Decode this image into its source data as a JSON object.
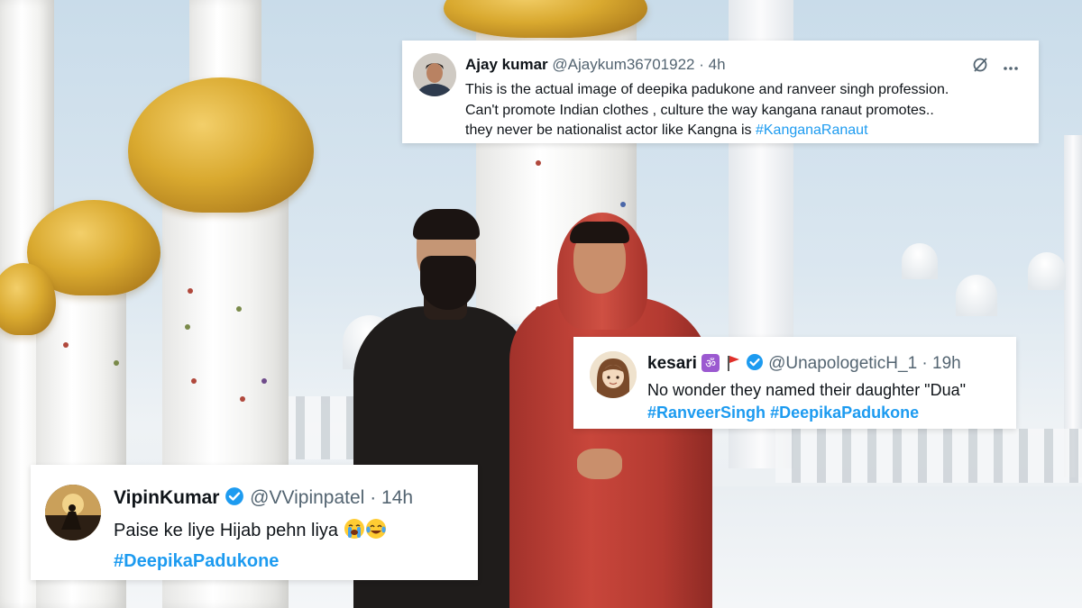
{
  "tweets": [
    {
      "name": "Ajay kumar",
      "handle": "@Ajaykum36701922",
      "time": "· 4h",
      "verified": false,
      "body_lines": [
        "This is the actual image of deepika padukone and ranveer singh profession.",
        "Can't promote Indian clothes , culture the way kangana ranaut promotes..",
        "they never be nationalist actor like Kangna is "
      ],
      "hashtags": [
        "#KanganaRanaut"
      ]
    },
    {
      "name": "kesari",
      "name_emojis": [
        "om-symbol-icon",
        "red-flag-icon"
      ],
      "handle": "@UnapologeticH_1",
      "time": "· 19h",
      "verified": true,
      "body_lines": [
        "No wonder they named their daughter \"Dua\""
      ],
      "hashtags": [
        "#RanveerSingh",
        "#DeepikaPadukone"
      ]
    },
    {
      "name": "VipinKumar",
      "handle": "@VVipinpatel",
      "time": "· 14h",
      "verified": true,
      "body_lines": [
        "Paise ke liye Hijab pehn liya "
      ],
      "body_emojis": [
        "loudly-crying-face-icon",
        "tears-of-joy-icon"
      ],
      "hashtags": [
        "#DeepikaPadukone"
      ]
    }
  ],
  "colors": {
    "link": "#1d9bf0",
    "handle": "#536471",
    "text": "#0f1419",
    "verified": "#1d9bf0"
  }
}
